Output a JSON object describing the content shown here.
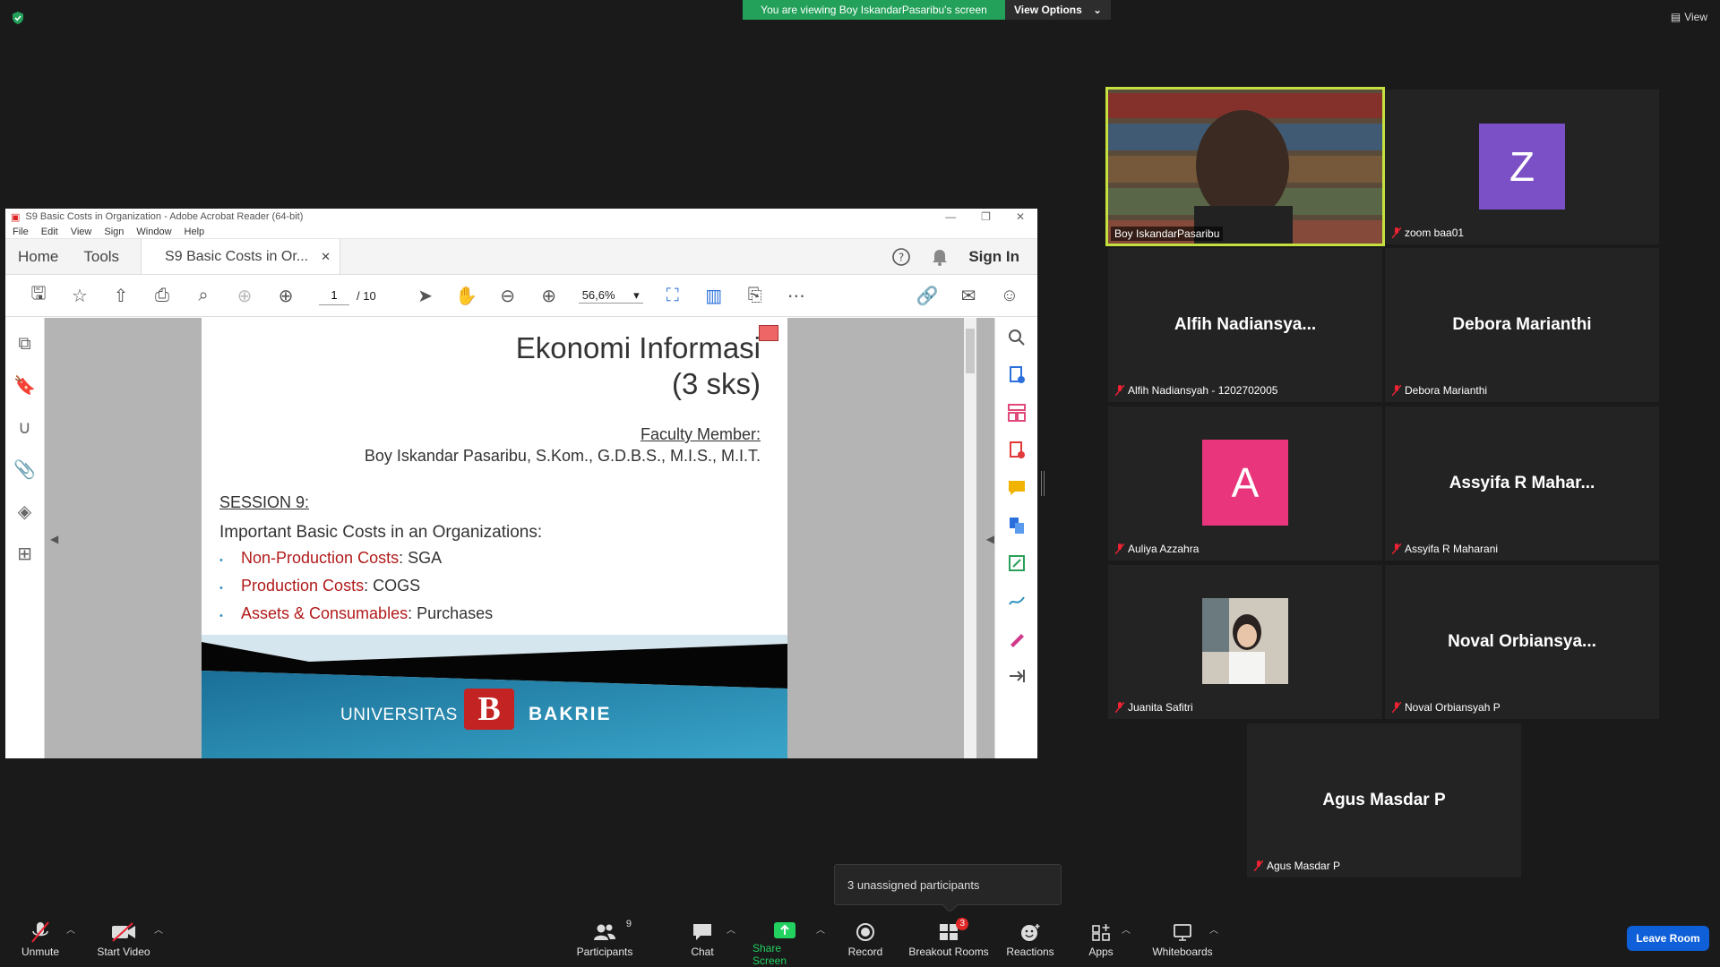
{
  "banner": {
    "viewing_text": "You are viewing Boy IskandarPasaribu's screen",
    "view_options": "View Options",
    "top_view": "View"
  },
  "acrobat": {
    "window_title": "S9 Basic Costs in Organization - Adobe Acrobat Reader (64-bit)",
    "menu": [
      "File",
      "Edit",
      "View",
      "Sign",
      "Window",
      "Help"
    ],
    "tabs": {
      "home": "Home",
      "tools": "Tools",
      "doc": "S9 Basic Costs in Or..."
    },
    "sign_in": "Sign In",
    "page_current": "1",
    "page_total": "/ 10",
    "zoom": "56,6%"
  },
  "slide": {
    "title_line1": "Ekonomi Informasi",
    "title_line2": "(3 sks)",
    "faculty_label": "Faculty Member:",
    "faculty_name": "Boy Iskandar Pasaribu, S.Kom., G.D.B.S., M.I.S., M.I.T.",
    "session": "SESSION 9:",
    "important": "Important Basic Costs in an Organizations:",
    "bullets": [
      {
        "key": "Non-Production Costs",
        "value": ": SGA"
      },
      {
        "key": "Production Costs",
        "value": ": COGS"
      },
      {
        "key": "Assets & Consumables",
        "value": ": Purchases"
      }
    ],
    "logo_uni": "UNIVERSITAS",
    "logo_letter": "B",
    "logo_bakrie": "BAKRIE"
  },
  "participants": [
    {
      "name": "Boy IskandarPasaribu",
      "type": "video"
    },
    {
      "name": "zoom baa01",
      "avatar": "Z",
      "avatar_color": "#7b4fc5"
    },
    {
      "name": "Alfih Nadiansyah - 1202702005",
      "display": "Alfih  Nadiansya..."
    },
    {
      "name": "Debora Marianthi",
      "display": "Debora Marianthi"
    },
    {
      "name": "Auliya Azzahra",
      "avatar": "A",
      "avatar_color": "#e8357b"
    },
    {
      "name": "Assyifa R Maharani",
      "display": "Assyifa R Mahar..."
    },
    {
      "name": "Juanita Safitri",
      "type": "photo"
    },
    {
      "name": "Noval Orbiansyah P",
      "display": "Noval  Orbiansya..."
    },
    {
      "name": "Agus Masdar P",
      "display": "Agus Masdar P"
    }
  ],
  "tooltip": "3 unassigned participants",
  "toolbar": {
    "unmute": "Unmute",
    "start_video": "Start Video",
    "participants": "Participants",
    "participants_count": "9",
    "chat": "Chat",
    "share_screen": "Share Screen",
    "record": "Record",
    "breakout_rooms": "Breakout Rooms",
    "breakout_badge": "3",
    "reactions": "Reactions",
    "apps": "Apps",
    "whiteboards": "Whiteboards",
    "leave": "Leave Room"
  },
  "colors": {
    "banner_green": "#23a15a",
    "active_speaker": "#c6e03f",
    "share_green": "#23d160",
    "leave_blue": "#0e5fd8"
  }
}
